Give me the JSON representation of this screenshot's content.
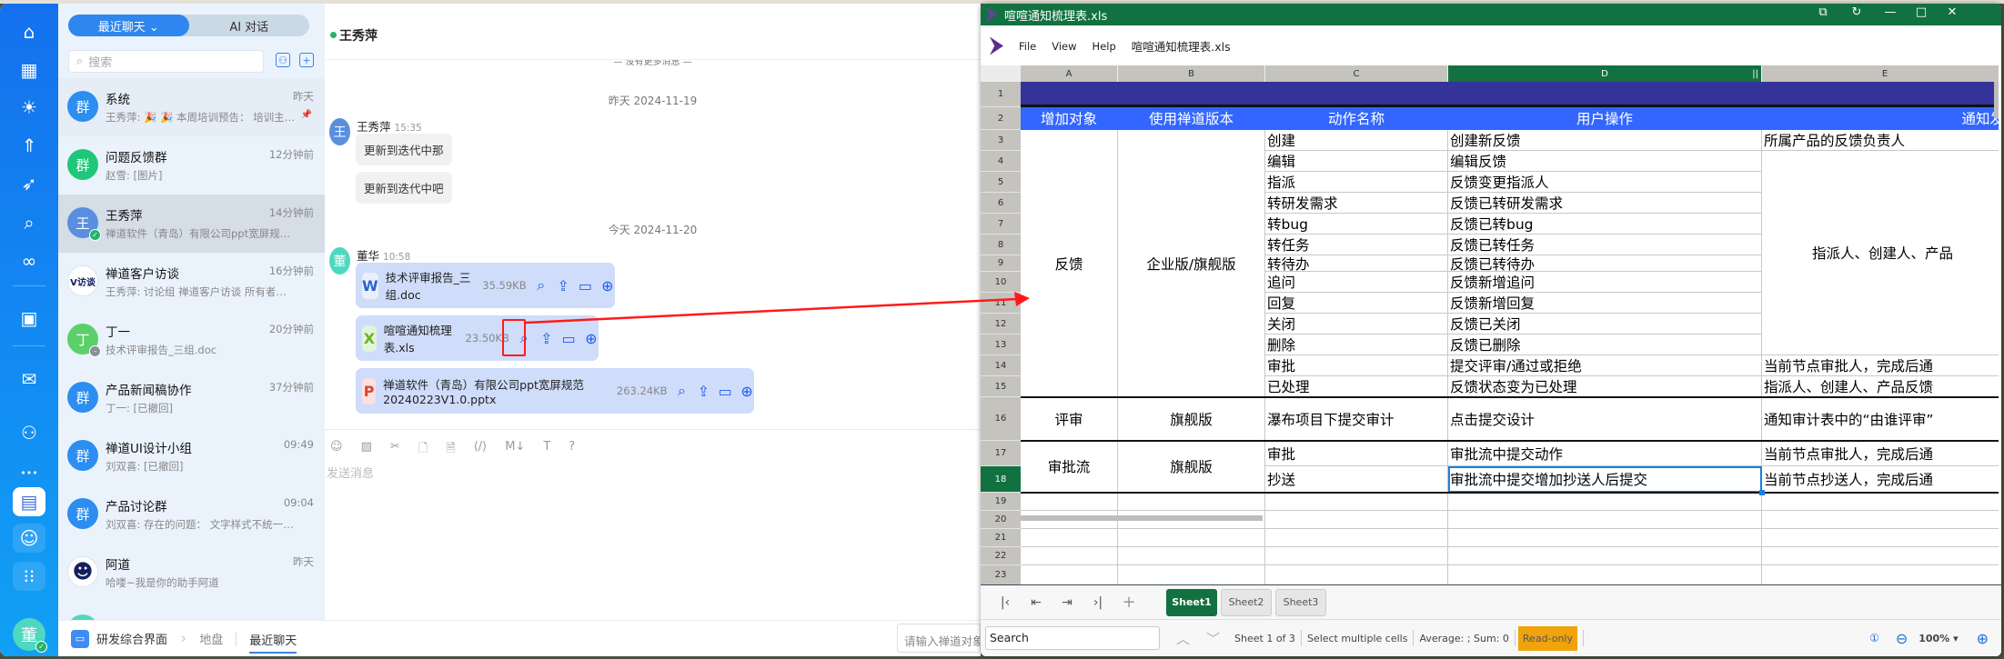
{
  "nav": {
    "icons": [
      "home-icon",
      "apps-icon",
      "bulb-icon",
      "rocket-icon",
      "sprint-icon",
      "search-icon",
      "infinity-icon",
      "presentation-icon",
      "inbox-icon",
      "contacts-share-icon",
      "more-icon",
      "chat-icon",
      "user-icon",
      "grid-icon"
    ],
    "me_initial": "董"
  },
  "list": {
    "tabs": {
      "recent": "最近聊天 ⌄",
      "ai": "AI 对话"
    },
    "search_placeholder": "搜索",
    "items": [
      {
        "name": "系统",
        "time": "昨天",
        "preview": "王秀萍: 🎉 🎉 本周培训预告： 培训主…",
        "avatar": "群",
        "color": "#2b8ef0",
        "pinned": true
      },
      {
        "name": "问题反馈群",
        "time": "12分钟前",
        "preview": "赵雪: [图片]",
        "avatar": "群",
        "color": "#1fc77a"
      },
      {
        "name": "王秀萍",
        "time": "14分钟前",
        "preview": "禅道软件（青岛）有限公司ppt宽屏规范2…",
        "avatar": "王",
        "color": "#5a8fe0",
        "status": "online",
        "selected": true
      },
      {
        "name": "禅道客户访谈",
        "time": "16分钟前",
        "preview": "王秀萍: 讨论组 禅道客户访谈 所有者更…",
        "avatar": "V访谈",
        "color": "#ffffff"
      },
      {
        "name": "丁一",
        "time": "20分钟前",
        "preview": "技术评审报告_三组.doc",
        "avatar": "丁",
        "color": "#5ccf6a",
        "status": "busy"
      },
      {
        "name": "产品新闻稿协作",
        "time": "37分钟前",
        "preview": "丁一: [已撤回]",
        "avatar": "群",
        "color": "#2b8ef0"
      },
      {
        "name": "禅道UI设计小组",
        "time": "09:49",
        "preview": "刘双喜: [已撤回]",
        "avatar": "群",
        "color": "#2b8ef0"
      },
      {
        "name": "产品讨论群",
        "time": "09:04",
        "preview": "刘双喜: 存在的问题： 文字样式不统一；…",
        "avatar": "群",
        "color": "#2b8ef0"
      },
      {
        "name": "阿道",
        "time": "昨天",
        "preview": "哈喽~我是你的助手阿道",
        "avatar": "☻",
        "color": "#ffffff"
      }
    ]
  },
  "breadcrumb": {
    "app": "研发综合界面",
    "items": [
      "地盘",
      "最近聊天"
    ]
  },
  "chat": {
    "title": "王秀萍",
    "no_more": "— 没有更多消息 —",
    "date1": "昨天 2024-11-19",
    "date2": "今天 2024-11-20",
    "msg1": {
      "sender": "王秀萍",
      "time": "15:35",
      "avatar": "王",
      "bubbles": [
        "更新到迭代中那",
        "更新到迭代中吧"
      ]
    },
    "msg2": {
      "sender": "董华",
      "time": "10:58",
      "avatar": "董",
      "files": [
        {
          "type": "W",
          "name": "技术评审报告_三组.doc",
          "size": "35.59KB"
        },
        {
          "type": "X",
          "name": "喧喧通知梳理表.xls",
          "size": "23.50KB"
        },
        {
          "type": "P",
          "name": "禅道软件（青岛）有限公司ppt宽屏规范20240223V1.0.pptx",
          "size": "263.24KB"
        }
      ]
    },
    "composer_placeholder": "发送消息",
    "object_input_placeholder": "请输入禅道对象"
  },
  "viewer": {
    "title": "喧喧通知梳理表.xls",
    "menu": [
      "File",
      "View",
      "Help"
    ],
    "filename": "喧喧通知梳理表.xls",
    "columns": [
      "A",
      "B",
      "C",
      "D",
      "E"
    ],
    "selected_col": "D",
    "selected_row": 18,
    "cells": [
      {
        "ref": "A1:E1",
        "text": "",
        "style": "dark"
      },
      {
        "ref": "A2",
        "text": "增加对象",
        "style": "hdr"
      },
      {
        "ref": "B2",
        "text": "使用禅道版本",
        "style": "hdr"
      },
      {
        "ref": "C2",
        "text": "动作名称",
        "style": "hdr"
      },
      {
        "ref": "D2",
        "text": "用户操作",
        "style": "hdr"
      },
      {
        "ref": "E2",
        "text": "通知发",
        "style": "hdr-r"
      },
      {
        "ref": "A3:A15",
        "text": "反馈",
        "style": "c"
      },
      {
        "ref": "B3:B15",
        "text": "企业版/旗舰版",
        "style": "c"
      },
      {
        "ref": "C3",
        "text": "创建"
      },
      {
        "ref": "C4",
        "text": "编辑"
      },
      {
        "ref": "C5",
        "text": "指派"
      },
      {
        "ref": "C6",
        "text": "转研发需求"
      },
      {
        "ref": "C7",
        "text": "转bug"
      },
      {
        "ref": "C8",
        "text": "转任务"
      },
      {
        "ref": "C9",
        "text": "转待办"
      },
      {
        "ref": "C10",
        "text": "追问"
      },
      {
        "ref": "C11",
        "text": "回复"
      },
      {
        "ref": "C12",
        "text": "关闭"
      },
      {
        "ref": "C13",
        "text": "删除"
      },
      {
        "ref": "C14",
        "text": "审批"
      },
      {
        "ref": "C15",
        "text": "已处理"
      },
      {
        "ref": "D3",
        "text": "创建新反馈"
      },
      {
        "ref": "D4",
        "text": "编辑反馈"
      },
      {
        "ref": "D5",
        "text": "反馈变更指派人"
      },
      {
        "ref": "D6",
        "text": "反馈已转研发需求"
      },
      {
        "ref": "D7",
        "text": "反馈已转bug"
      },
      {
        "ref": "D8",
        "text": "反馈已转任务"
      },
      {
        "ref": "D9",
        "text": "反馈已转待办"
      },
      {
        "ref": "D10",
        "text": "反馈新增追问"
      },
      {
        "ref": "D11",
        "text": "反馈新增回复"
      },
      {
        "ref": "D12",
        "text": "反馈已关闭"
      },
      {
        "ref": "D13",
        "text": "反馈已删除"
      },
      {
        "ref": "D14",
        "text": "提交评审/通过或拒绝"
      },
      {
        "ref": "D15",
        "text": "反馈状态变为已处理"
      },
      {
        "ref": "E3",
        "text": "所属产品的反馈负责人"
      },
      {
        "ref": "E4:E13",
        "text": "指派人、创建人、产品",
        "style": "pad"
      },
      {
        "ref": "E14",
        "text": "当前节点审批人，完成后通"
      },
      {
        "ref": "E15",
        "text": "指派人、创建人、产品反馈"
      },
      {
        "ref": "A16",
        "text": "评审",
        "style": "c"
      },
      {
        "ref": "B16",
        "text": "旗舰版",
        "style": "c"
      },
      {
        "ref": "C16",
        "text": "瀑布项目下提交审计"
      },
      {
        "ref": "D16",
        "text": "点击提交设计"
      },
      {
        "ref": "E16",
        "text": "通知审计表中的“由谁评审”"
      },
      {
        "ref": "A17:A18",
        "text": "审批流",
        "style": "c"
      },
      {
        "ref": "B17:B18",
        "text": "旗舰版",
        "style": "c"
      },
      {
        "ref": "C17",
        "text": "审批"
      },
      {
        "ref": "C18",
        "text": "抄送"
      },
      {
        "ref": "D17",
        "text": "审批流中提交动作"
      },
      {
        "ref": "D18",
        "text": "审批流中提交增加抄送人后提交",
        "style": "sel"
      },
      {
        "ref": "E17",
        "text": "当前节点审批人，完成后通"
      },
      {
        "ref": "E18",
        "text": "当前节点抄送人，完成后通"
      }
    ],
    "sheets": [
      "Sheet1",
      "Sheet2",
      "Sheet3"
    ],
    "active_sheet": "Sheet1",
    "status": {
      "search_placeholder": "Search",
      "sheet_info": "Sheet 1 of 3",
      "select_hint": "Select multiple cells",
      "summary": "Average: ; Sum: 0",
      "readonly": "Read-only",
      "zoom": "100%"
    }
  },
  "colors": {
    "brand_green": "#127140",
    "header_blue": "#3366ff",
    "title_row": "#333399",
    "annotation": "#ff1a1a"
  }
}
